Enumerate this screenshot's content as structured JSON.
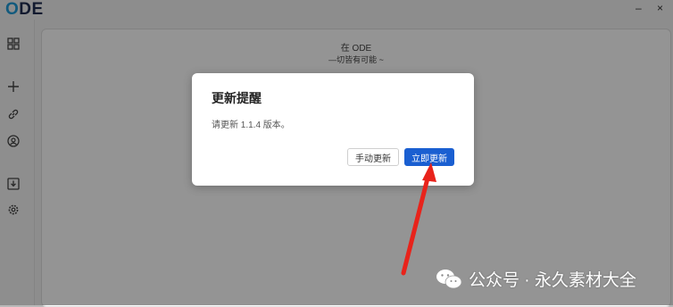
{
  "app": {
    "logo_text": "DE",
    "minimize": "–",
    "close": "×"
  },
  "welcome": {
    "title": "在 ODE",
    "subtitle": "—切皆有可能 ~"
  },
  "dialog": {
    "title": "更新提醒",
    "message": "请更新 1.1.4 版本。",
    "manual_button": "手动更新",
    "update_now_button": "立即更新"
  },
  "watermark": {
    "text": "公众号 · 永久素材大全"
  },
  "colors": {
    "primary": "#1a5fd1",
    "arrow": "#e8231b",
    "logo": "#1f2d52",
    "logo_accent": "#1f9bd7"
  }
}
